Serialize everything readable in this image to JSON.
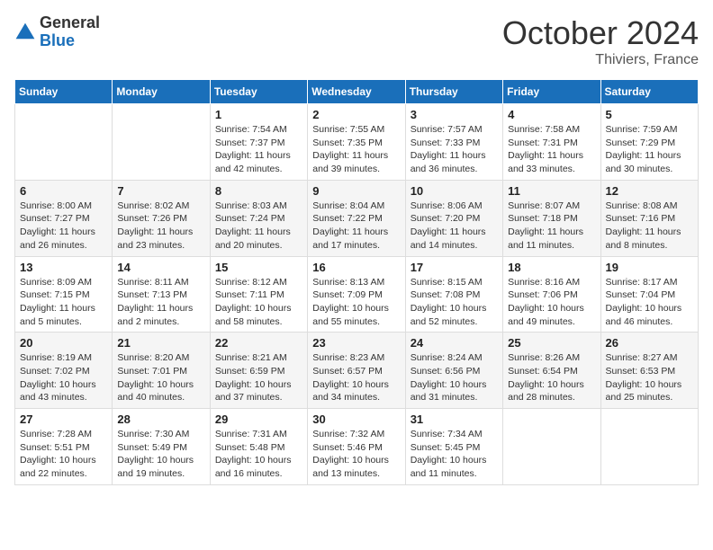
{
  "logo": {
    "general": "General",
    "blue": "Blue"
  },
  "header": {
    "month": "October 2024",
    "location": "Thiviers, France"
  },
  "weekdays": [
    "Sunday",
    "Monday",
    "Tuesday",
    "Wednesday",
    "Thursday",
    "Friday",
    "Saturday"
  ],
  "weeks": [
    [
      {
        "day": "",
        "sunrise": "",
        "sunset": "",
        "daylight": ""
      },
      {
        "day": "",
        "sunrise": "",
        "sunset": "",
        "daylight": ""
      },
      {
        "day": "1",
        "sunrise": "Sunrise: 7:54 AM",
        "sunset": "Sunset: 7:37 PM",
        "daylight": "Daylight: 11 hours and 42 minutes."
      },
      {
        "day": "2",
        "sunrise": "Sunrise: 7:55 AM",
        "sunset": "Sunset: 7:35 PM",
        "daylight": "Daylight: 11 hours and 39 minutes."
      },
      {
        "day": "3",
        "sunrise": "Sunrise: 7:57 AM",
        "sunset": "Sunset: 7:33 PM",
        "daylight": "Daylight: 11 hours and 36 minutes."
      },
      {
        "day": "4",
        "sunrise": "Sunrise: 7:58 AM",
        "sunset": "Sunset: 7:31 PM",
        "daylight": "Daylight: 11 hours and 33 minutes."
      },
      {
        "day": "5",
        "sunrise": "Sunrise: 7:59 AM",
        "sunset": "Sunset: 7:29 PM",
        "daylight": "Daylight: 11 hours and 30 minutes."
      }
    ],
    [
      {
        "day": "6",
        "sunrise": "Sunrise: 8:00 AM",
        "sunset": "Sunset: 7:27 PM",
        "daylight": "Daylight: 11 hours and 26 minutes."
      },
      {
        "day": "7",
        "sunrise": "Sunrise: 8:02 AM",
        "sunset": "Sunset: 7:26 PM",
        "daylight": "Daylight: 11 hours and 23 minutes."
      },
      {
        "day": "8",
        "sunrise": "Sunrise: 8:03 AM",
        "sunset": "Sunset: 7:24 PM",
        "daylight": "Daylight: 11 hours and 20 minutes."
      },
      {
        "day": "9",
        "sunrise": "Sunrise: 8:04 AM",
        "sunset": "Sunset: 7:22 PM",
        "daylight": "Daylight: 11 hours and 17 minutes."
      },
      {
        "day": "10",
        "sunrise": "Sunrise: 8:06 AM",
        "sunset": "Sunset: 7:20 PM",
        "daylight": "Daylight: 11 hours and 14 minutes."
      },
      {
        "day": "11",
        "sunrise": "Sunrise: 8:07 AM",
        "sunset": "Sunset: 7:18 PM",
        "daylight": "Daylight: 11 hours and 11 minutes."
      },
      {
        "day": "12",
        "sunrise": "Sunrise: 8:08 AM",
        "sunset": "Sunset: 7:16 PM",
        "daylight": "Daylight: 11 hours and 8 minutes."
      }
    ],
    [
      {
        "day": "13",
        "sunrise": "Sunrise: 8:09 AM",
        "sunset": "Sunset: 7:15 PM",
        "daylight": "Daylight: 11 hours and 5 minutes."
      },
      {
        "day": "14",
        "sunrise": "Sunrise: 8:11 AM",
        "sunset": "Sunset: 7:13 PM",
        "daylight": "Daylight: 11 hours and 2 minutes."
      },
      {
        "day": "15",
        "sunrise": "Sunrise: 8:12 AM",
        "sunset": "Sunset: 7:11 PM",
        "daylight": "Daylight: 10 hours and 58 minutes."
      },
      {
        "day": "16",
        "sunrise": "Sunrise: 8:13 AM",
        "sunset": "Sunset: 7:09 PM",
        "daylight": "Daylight: 10 hours and 55 minutes."
      },
      {
        "day": "17",
        "sunrise": "Sunrise: 8:15 AM",
        "sunset": "Sunset: 7:08 PM",
        "daylight": "Daylight: 10 hours and 52 minutes."
      },
      {
        "day": "18",
        "sunrise": "Sunrise: 8:16 AM",
        "sunset": "Sunset: 7:06 PM",
        "daylight": "Daylight: 10 hours and 49 minutes."
      },
      {
        "day": "19",
        "sunrise": "Sunrise: 8:17 AM",
        "sunset": "Sunset: 7:04 PM",
        "daylight": "Daylight: 10 hours and 46 minutes."
      }
    ],
    [
      {
        "day": "20",
        "sunrise": "Sunrise: 8:19 AM",
        "sunset": "Sunset: 7:02 PM",
        "daylight": "Daylight: 10 hours and 43 minutes."
      },
      {
        "day": "21",
        "sunrise": "Sunrise: 8:20 AM",
        "sunset": "Sunset: 7:01 PM",
        "daylight": "Daylight: 10 hours and 40 minutes."
      },
      {
        "day": "22",
        "sunrise": "Sunrise: 8:21 AM",
        "sunset": "Sunset: 6:59 PM",
        "daylight": "Daylight: 10 hours and 37 minutes."
      },
      {
        "day": "23",
        "sunrise": "Sunrise: 8:23 AM",
        "sunset": "Sunset: 6:57 PM",
        "daylight": "Daylight: 10 hours and 34 minutes."
      },
      {
        "day": "24",
        "sunrise": "Sunrise: 8:24 AM",
        "sunset": "Sunset: 6:56 PM",
        "daylight": "Daylight: 10 hours and 31 minutes."
      },
      {
        "day": "25",
        "sunrise": "Sunrise: 8:26 AM",
        "sunset": "Sunset: 6:54 PM",
        "daylight": "Daylight: 10 hours and 28 minutes."
      },
      {
        "day": "26",
        "sunrise": "Sunrise: 8:27 AM",
        "sunset": "Sunset: 6:53 PM",
        "daylight": "Daylight: 10 hours and 25 minutes."
      }
    ],
    [
      {
        "day": "27",
        "sunrise": "Sunrise: 7:28 AM",
        "sunset": "Sunset: 5:51 PM",
        "daylight": "Daylight: 10 hours and 22 minutes."
      },
      {
        "day": "28",
        "sunrise": "Sunrise: 7:30 AM",
        "sunset": "Sunset: 5:49 PM",
        "daylight": "Daylight: 10 hours and 19 minutes."
      },
      {
        "day": "29",
        "sunrise": "Sunrise: 7:31 AM",
        "sunset": "Sunset: 5:48 PM",
        "daylight": "Daylight: 10 hours and 16 minutes."
      },
      {
        "day": "30",
        "sunrise": "Sunrise: 7:32 AM",
        "sunset": "Sunset: 5:46 PM",
        "daylight": "Daylight: 10 hours and 13 minutes."
      },
      {
        "day": "31",
        "sunrise": "Sunrise: 7:34 AM",
        "sunset": "Sunset: 5:45 PM",
        "daylight": "Daylight: 10 hours and 11 minutes."
      },
      {
        "day": "",
        "sunrise": "",
        "sunset": "",
        "daylight": ""
      },
      {
        "day": "",
        "sunrise": "",
        "sunset": "",
        "daylight": ""
      }
    ]
  ]
}
